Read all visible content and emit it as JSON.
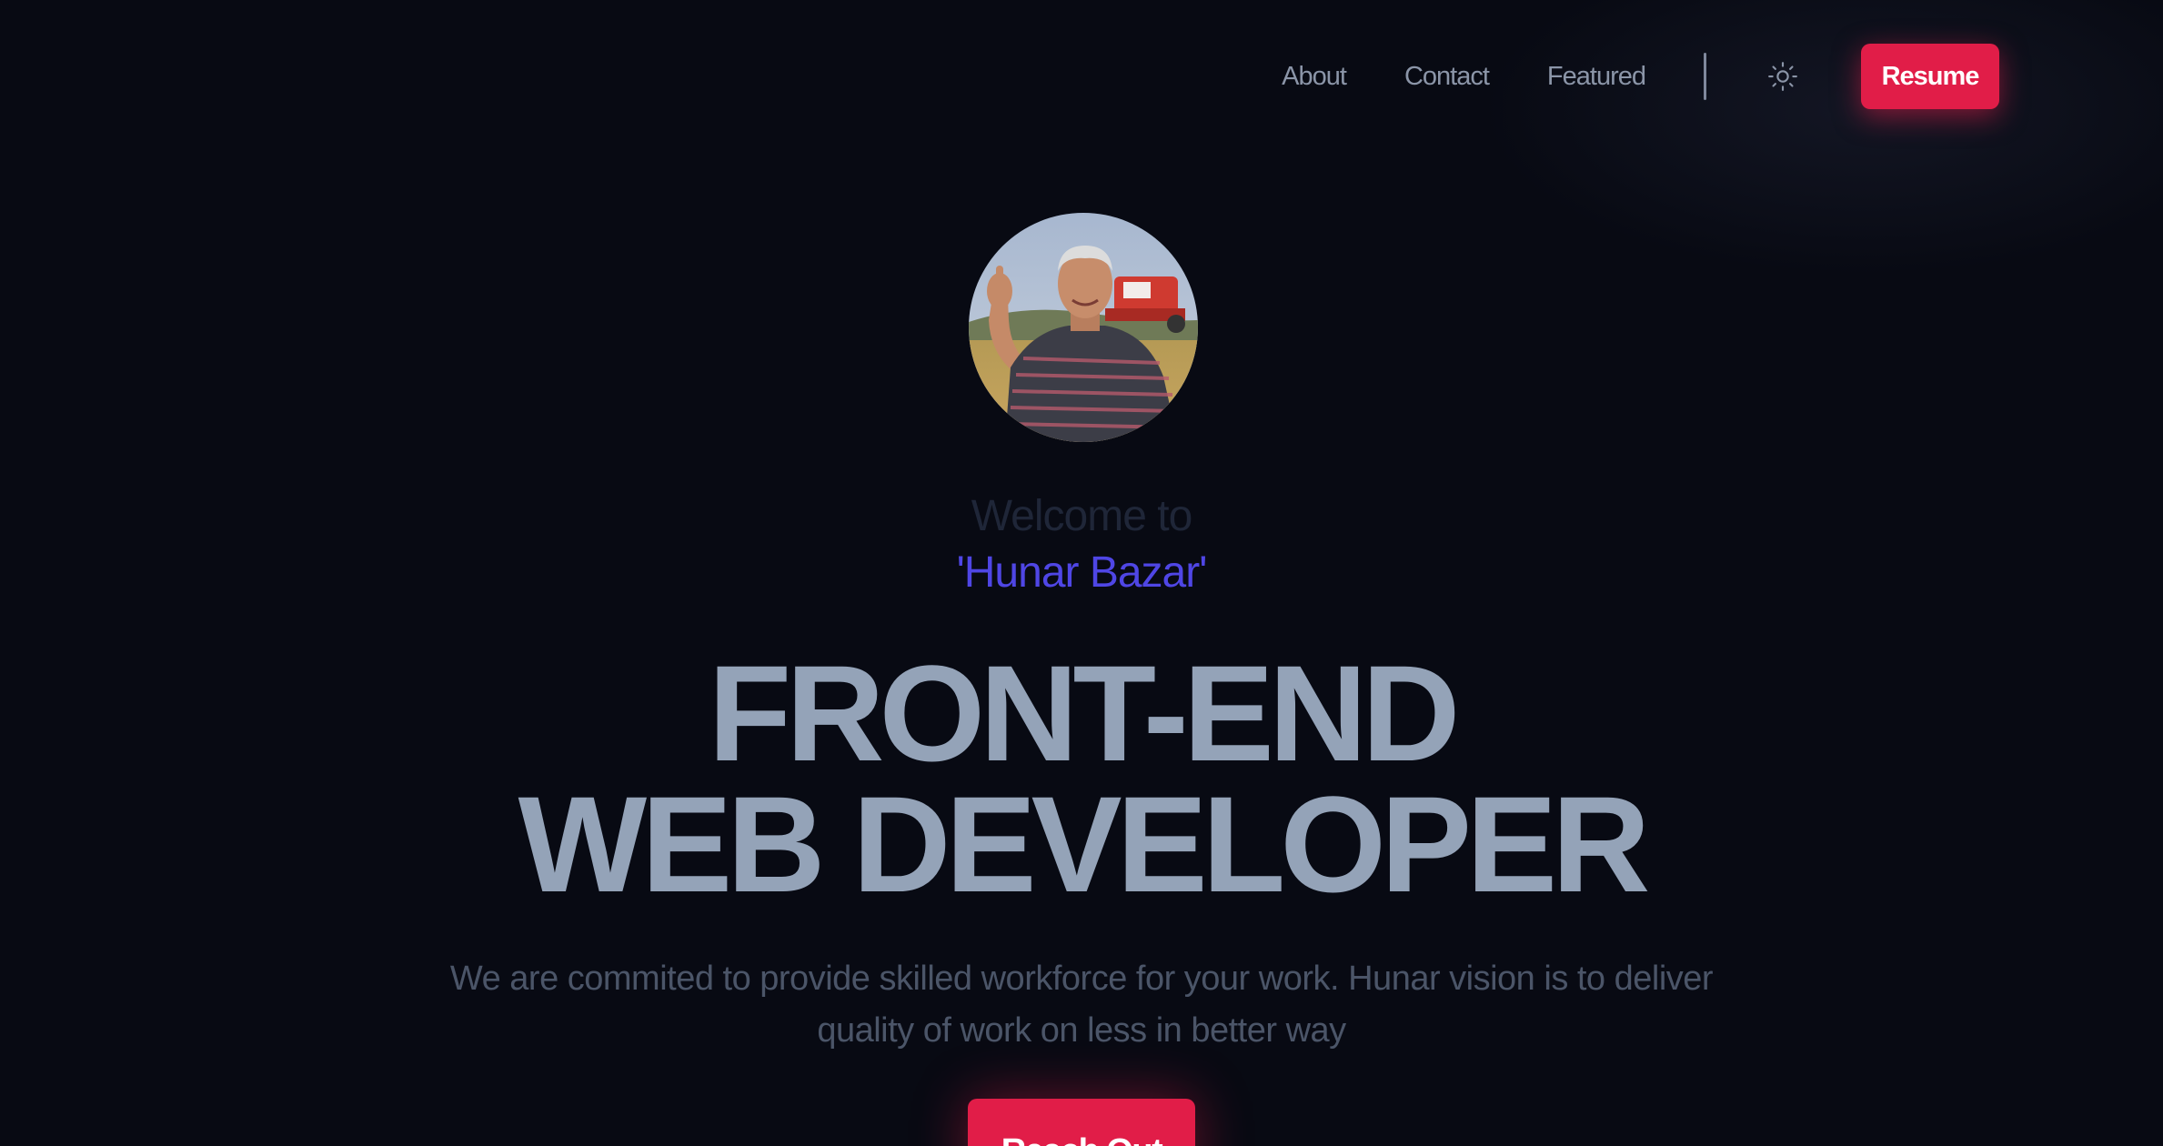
{
  "nav": {
    "links": [
      "About",
      "Contact",
      "Featured"
    ],
    "theme_icon": "sun-icon",
    "resume_label": "Resume"
  },
  "hero": {
    "avatar_alt": "profile-photo",
    "welcome": "Welcome to",
    "brand": "'Hunar Bazar'",
    "headline_line1": "FRONT-END",
    "headline_line2": "WEB DEVELOPER",
    "tagline": "We are commited to provide skilled workforce for your work. Hunar vision is to deliver quality of work on less in better way",
    "cta_label": "Reach Out"
  },
  "colors": {
    "background": "#080a13",
    "accent": "#e11d48",
    "brand": "#4f46e5",
    "headline": "#94a3b8"
  }
}
